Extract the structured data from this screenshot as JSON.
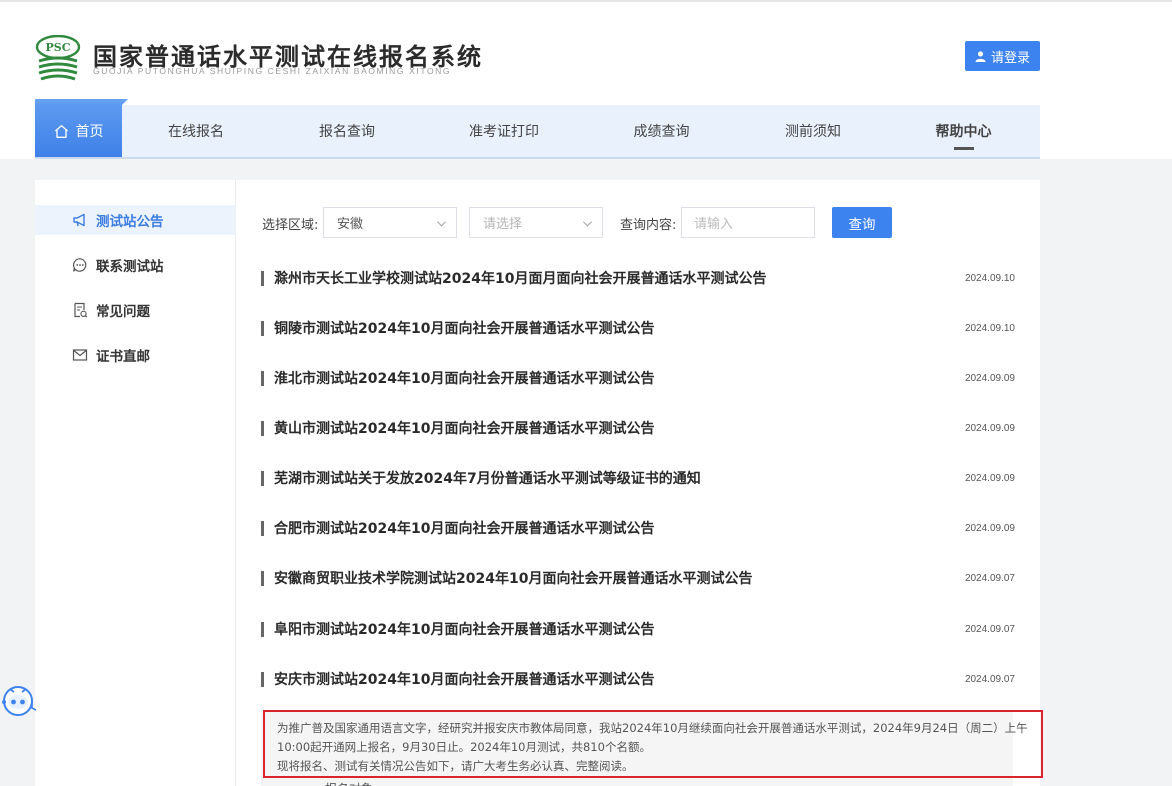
{
  "header": {
    "badge_text": "PSC",
    "title": "国家普通话水平测试在线报名系统",
    "subtitle": "GUOJIA PUTONGHUA SHUIPING CESHI ZAIXIAN BAOMING XITONG",
    "login_label": "请登录"
  },
  "nav": {
    "items": [
      {
        "label": "首页"
      },
      {
        "label": "在线报名"
      },
      {
        "label": "报名查询"
      },
      {
        "label": "准考证打印"
      },
      {
        "label": "成绩查询"
      },
      {
        "label": "测前须知"
      },
      {
        "label": "帮助中心"
      }
    ],
    "active": "帮助中心"
  },
  "sidebar": {
    "items": [
      {
        "label": "测试站公告",
        "icon": "megaphone-icon"
      },
      {
        "label": "联系测试站",
        "icon": "chat-icon"
      },
      {
        "label": "常见问题",
        "icon": "faq-doc-icon"
      },
      {
        "label": "证书直邮",
        "icon": "mail-icon"
      }
    ],
    "active": "测试站公告"
  },
  "filter": {
    "region_label": "选择区域:",
    "province_value": "安徽",
    "city_placeholder": "请选择",
    "query_label": "查询内容:",
    "query_placeholder": "请输入",
    "query_button": "查询"
  },
  "announcements": [
    {
      "title": "滁州市天长工业学校测试站2024年10月面月面向社会开展普通话水平测试公告",
      "date": "2024.09.10"
    },
    {
      "title": "铜陵市测试站2024年10月面向社会开展普通话水平测试公告",
      "date": "2024.09.10"
    },
    {
      "title": "淮北市测试站2024年10月面向社会开展普通话水平测试公告",
      "date": "2024.09.09"
    },
    {
      "title": "黄山市测试站2024年10月面向社会开展普通话水平测试公告",
      "date": "2024.09.09"
    },
    {
      "title": "芜湖市测试站关于发放2024年7月份普通话水平测试等级证书的通知",
      "date": "2024.09.09"
    },
    {
      "title": "合肥市测试站2024年10月面向社会开展普通话水平测试公告",
      "date": "2024.09.09"
    },
    {
      "title": "安徽商贸职业技术学院测试站2024年10月面向社会开展普通话水平测试公告",
      "date": "2024.09.07"
    },
    {
      "title": "阜阳市测试站2024年10月面向社会开展普通话水平测试公告",
      "date": "2024.09.07"
    },
    {
      "title": "安庆市测试站2024年10月面向社会开展普通话水平测试公告",
      "date": "2024.09.07"
    }
  ],
  "notice": {
    "line1": "为推广普及国家通用语言文字，经研究并报安庆市教体局同意，我站2024年10月继续面向社会开展普通话水平测试，2024年9月24日（周二）上午10:00起开通网上报名，9月30日止。2024年10月测试，共810个名额。",
    "line2": "现将报名、测试有关情况公告如下，请广大考生务必认真、完整阅读。",
    "tail": "一、报名对象"
  },
  "colors": {
    "primary": "#3d83f0",
    "nav_bg": "#e9f1fc",
    "highlight_border": "#d9262c",
    "logo_green": "#2f8a3e"
  }
}
